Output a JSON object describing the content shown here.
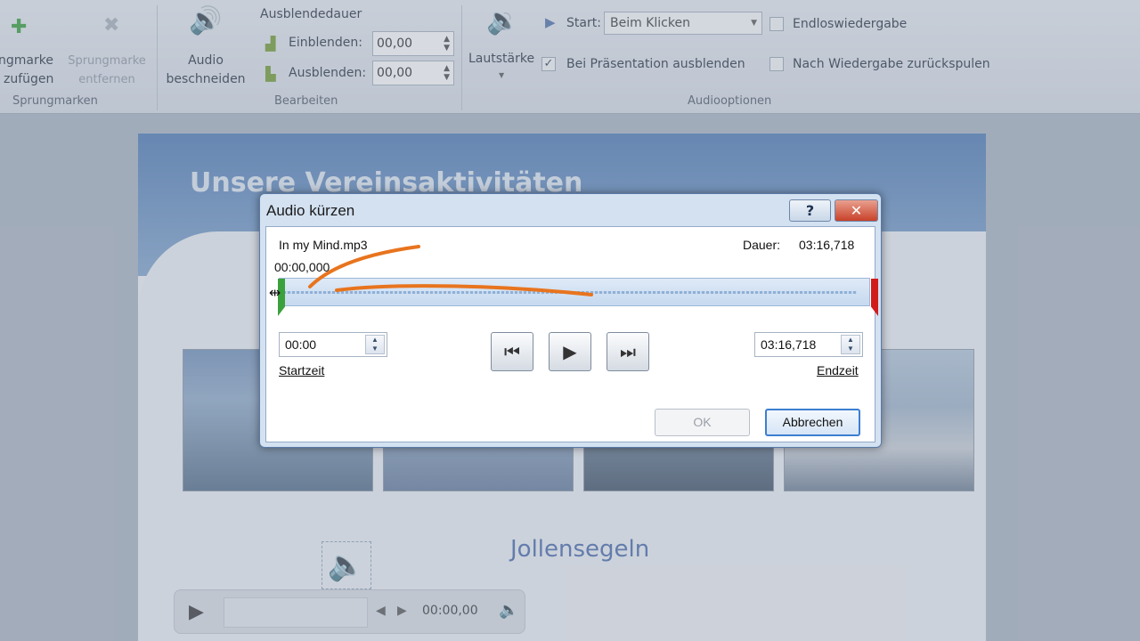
{
  "ribbon": {
    "add_marker": [
      "ngmarke",
      "zufügen"
    ],
    "remove_marker": [
      "Sprungmarke",
      "entfernen"
    ],
    "markers_group": "Sprungmarken",
    "trim_audio": [
      "Audio",
      "beschneiden"
    ],
    "fade_duration": "Ausblendedauer",
    "fade_in_label": "Einblenden:",
    "fade_in_value": "00,00",
    "fade_out_label": "Ausblenden:",
    "fade_out_value": "00,00",
    "edit_group": "Bearbeiten",
    "volume": "Lautstärke",
    "start_label": "Start:",
    "start_value": "Beim Klicken",
    "loop": "Endloswiedergabe",
    "hide_during_show": "Bei Präsentation ausblenden",
    "rewind_after": "Nach Wiedergabe zurückspulen",
    "audio_options_group": "Audiooptionen"
  },
  "slide": {
    "title": "Unsere Vereinsaktivitäten",
    "caption": "Jollensegeln",
    "player_time": "00:00,00"
  },
  "dialog": {
    "title": "Audio kürzen",
    "help": "?",
    "close": "✕",
    "filename": "In my Mind.mp3",
    "duration_label": "Dauer:",
    "duration_value": "03:16,718",
    "position": "00:00,000",
    "start_value": "00:00",
    "start_label": "Startzeit",
    "end_value": "03:16,718",
    "end_label": "Endzeit",
    "ok": "OK",
    "cancel": "Abbrechen"
  },
  "colors": {
    "accent": "#3c7fd1",
    "start_handle": "#3aa13c",
    "end_handle": "#d11c1c",
    "pen_annotation": "#e8741e"
  }
}
